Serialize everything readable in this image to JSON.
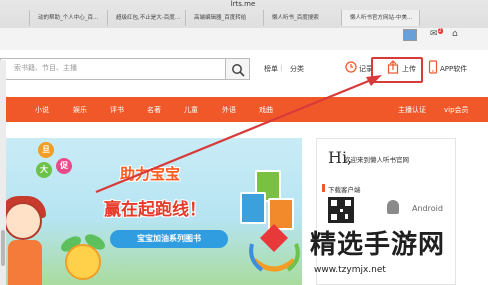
{
  "browser": {
    "url": "lrts.me",
    "tabs": [
      "",
      "动的帮助_个人中心_百...",
      "超级红包,不止是大-百度...",
      "高端编辑器_百度转给",
      "懒人听书_百度搜索",
      "懒人听书官方网站-中美..."
    ],
    "mail_badge": "2"
  },
  "header": {
    "search_placeholder": "索书籍、节目、主播",
    "links": {
      "rank": "榜单",
      "category": "分类"
    },
    "actions": {
      "history": "记录",
      "upload": "上传",
      "app": "APP软件"
    }
  },
  "nav": {
    "items": [
      "小说",
      "娱乐",
      "评书",
      "名著",
      "儿童",
      "外语",
      "戏曲"
    ],
    "right_items": [
      "主播认证",
      "vip会员"
    ]
  },
  "banner": {
    "bubbles": [
      "旦",
      "大",
      "促"
    ],
    "line1": "助力宝宝",
    "line2": "赢在起跑线！",
    "series": "宝宝加油系列图书"
  },
  "panel": {
    "hi": "Hi,",
    "welcome": "欢迎来到懒人听书官网",
    "download_title": "下载客户端",
    "android": "Android"
  },
  "watermark": {
    "text": "精选手游网",
    "url": "www.tzymjx.net"
  },
  "colors": {
    "nav_bg": "#f0582a",
    "annotation": "#d83a3a"
  }
}
